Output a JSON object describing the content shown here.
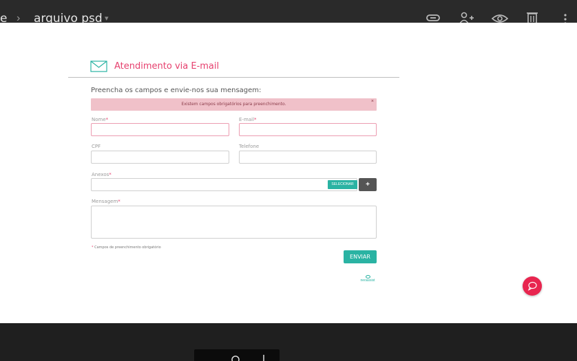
{
  "topbar": {
    "breadcrumb_prev": "e",
    "separator": "›",
    "file_name": "arquivo psd",
    "caret": "▾",
    "icons": [
      "link-icon",
      "add-person-icon",
      "eye-icon",
      "trash-icon",
      "more-vert-icon"
    ]
  },
  "form": {
    "title": "Atendimento via E-mail",
    "intro": "Preencha os campos e envie-nos sua mensagem:",
    "alert": {
      "text": "Existem campos obrigatórios para preenchimento.",
      "close": "×"
    },
    "required_mark": "*",
    "fields": {
      "nome": "Nome",
      "email": "E-mail",
      "cpf": "CPF",
      "telefone": "Telefone",
      "anexos": "Anexos",
      "mensagem": "Mensagem"
    },
    "select_label": "SELECIONAR",
    "add_label": "+",
    "footnote": "Campos de preenchimento obrigatório",
    "send_label": "ENVIAR",
    "logo_text": "neoassist"
  },
  "colors": {
    "accent_pink": "#e6406e",
    "teal": "#2ab3a3",
    "alert_bg": "#f0c1c9",
    "chat_red": "#e8254f"
  }
}
